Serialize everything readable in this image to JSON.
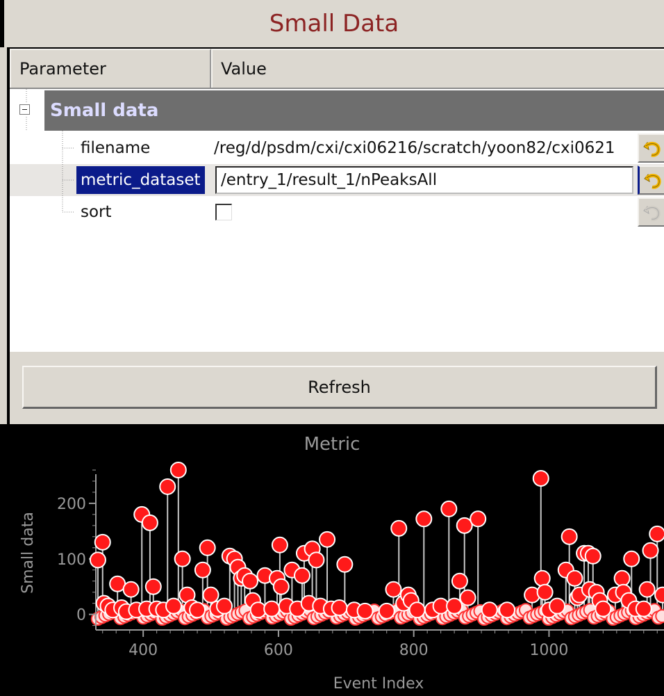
{
  "panel": {
    "title": "Small Data"
  },
  "tree": {
    "headers": {
      "parameter": "Parameter",
      "value": "Value"
    },
    "group": {
      "label": "Small data",
      "expanded": true
    },
    "rows": [
      {
        "name": "filename",
        "value": "/reg/d/psdm/cxi/cxi06216/scratch/yoon82/cxi0621"
      },
      {
        "name": "metric_dataset",
        "value": "/entry_1/result_1/nPeaksAll",
        "selected": true
      },
      {
        "name": "sort",
        "checked": false
      }
    ],
    "reset_icon": "undo-arrow-icon"
  },
  "refresh_label": "Refresh",
  "colors": {
    "title": "#8c2323",
    "selection": "#0b1b8a",
    "marker": "#ff1a1a",
    "plot_bg": "#000000",
    "axis": "#9a9a9a"
  },
  "chart_data": {
    "type": "scatter",
    "title": "Metric",
    "xlabel": "Event Index",
    "ylabel": "Small data",
    "xlim": [
      330,
      1170
    ],
    "ylim": [
      -28,
      265
    ],
    "xticks": [
      400,
      600,
      800,
      1000
    ],
    "yticks": [
      0,
      100,
      200
    ],
    "grid": false,
    "stems": true,
    "highlight_points": [
      [
        333,
        98
      ],
      [
        340,
        130
      ],
      [
        342,
        20
      ],
      [
        348,
        15
      ],
      [
        355,
        8
      ],
      [
        362,
        55
      ],
      [
        368,
        12
      ],
      [
        375,
        5
      ],
      [
        382,
        45
      ],
      [
        390,
        8
      ],
      [
        398,
        180
      ],
      [
        405,
        10
      ],
      [
        410,
        165
      ],
      [
        415,
        50
      ],
      [
        420,
        10
      ],
      [
        430,
        8
      ],
      [
        436,
        230
      ],
      [
        445,
        15
      ],
      [
        452,
        260
      ],
      [
        458,
        100
      ],
      [
        465,
        35
      ],
      [
        472,
        12
      ],
      [
        480,
        8
      ],
      [
        488,
        80
      ],
      [
        495,
        120
      ],
      [
        500,
        35
      ],
      [
        510,
        10
      ],
      [
        520,
        15
      ],
      [
        528,
        105
      ],
      [
        535,
        100
      ],
      [
        540,
        85
      ],
      [
        545,
        65
      ],
      [
        550,
        70
      ],
      [
        558,
        60
      ],
      [
        562,
        25
      ],
      [
        570,
        8
      ],
      [
        580,
        70
      ],
      [
        590,
        10
      ],
      [
        598,
        65
      ],
      [
        602,
        125
      ],
      [
        604,
        50
      ],
      [
        612,
        15
      ],
      [
        620,
        80
      ],
      [
        628,
        10
      ],
      [
        635,
        70
      ],
      [
        638,
        110
      ],
      [
        645,
        20
      ],
      [
        650,
        118
      ],
      [
        656,
        98
      ],
      [
        662,
        15
      ],
      [
        672,
        135
      ],
      [
        678,
        10
      ],
      [
        690,
        12
      ],
      [
        698,
        90
      ],
      [
        712,
        8
      ],
      [
        728,
        6
      ],
      [
        760,
        6
      ],
      [
        770,
        45
      ],
      [
        778,
        155
      ],
      [
        785,
        20
      ],
      [
        792,
        35
      ],
      [
        796,
        25
      ],
      [
        805,
        8
      ],
      [
        815,
        172
      ],
      [
        828,
        8
      ],
      [
        840,
        15
      ],
      [
        852,
        190
      ],
      [
        860,
        15
      ],
      [
        868,
        60
      ],
      [
        875,
        160
      ],
      [
        880,
        30
      ],
      [
        895,
        172
      ],
      [
        912,
        8
      ],
      [
        938,
        8
      ],
      [
        975,
        35
      ],
      [
        988,
        245
      ],
      [
        990,
        65
      ],
      [
        994,
        40
      ],
      [
        1000,
        8
      ],
      [
        1012,
        15
      ],
      [
        1025,
        80
      ],
      [
        1030,
        140
      ],
      [
        1038,
        65
      ],
      [
        1042,
        30
      ],
      [
        1045,
        35
      ],
      [
        1052,
        110
      ],
      [
        1058,
        110
      ],
      [
        1060,
        45
      ],
      [
        1065,
        105
      ],
      [
        1070,
        40
      ],
      [
        1075,
        25
      ],
      [
        1080,
        10
      ],
      [
        1098,
        35
      ],
      [
        1108,
        65
      ],
      [
        1110,
        40
      ],
      [
        1118,
        25
      ],
      [
        1122,
        100
      ],
      [
        1128,
        10
      ],
      [
        1140,
        10
      ],
      [
        1145,
        45
      ],
      [
        1150,
        115
      ],
      [
        1160,
        145
      ],
      [
        1168,
        35
      ]
    ],
    "baseline_points_range": {
      "x": [
        330,
        1170
      ],
      "y": [
        -8,
        8
      ]
    }
  }
}
